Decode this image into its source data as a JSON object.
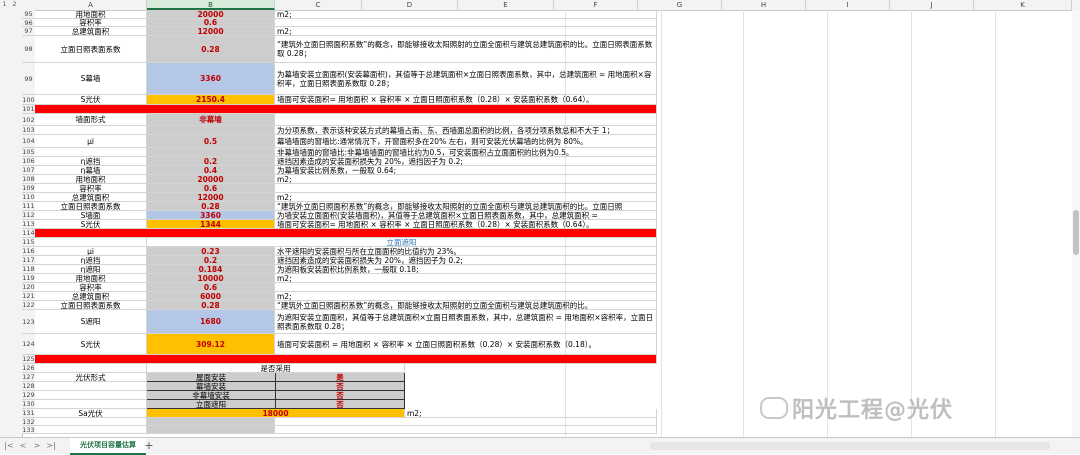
{
  "columns": [
    "A",
    "B",
    "C",
    "D",
    "E",
    "F",
    "G",
    "H",
    "I",
    "J",
    "K"
  ],
  "outline_buttons": [
    "1",
    "2"
  ],
  "rows": [
    {
      "n": "95",
      "a": "用地面积",
      "b": "20000",
      "c": "m2;"
    },
    {
      "n": "96",
      "a": "容积率",
      "b": "0.6",
      "c": ""
    },
    {
      "n": "97",
      "a": "总建筑面积",
      "b": "12000",
      "c": "m2;"
    },
    {
      "n": "98",
      "a": "立面日照表面系数",
      "b": "0.28",
      "c": "“建筑外立面日照面积系数”的概念，即能够接收太阳照射的立面全面积与建筑总建筑面积的比。立面日照表面系数取 0.28；"
    },
    {
      "n": "99",
      "a": "S幕墙",
      "b": "3360",
      "c": "为幕墙安装立面面积(安装幕面积)，其值等于总建筑面积×立面日照表面系数，其中，总建筑面积 = 用地面积×容积率，立面日照表面系数取 0.28；"
    },
    {
      "n": "100",
      "a": "S光伏",
      "b": "2150.4",
      "c": "墙面可安装面积= 用地面积 × 容积率 × 立面日照面积系数（0.28）× 安装面积系数（0.64）。"
    },
    {
      "n": "101",
      "a": "",
      "b": "",
      "c": ""
    },
    {
      "n": "102",
      "a": "墙面形式",
      "b": "非幕墙",
      "c": ""
    },
    {
      "n": "103",
      "a": "",
      "b": "",
      "c": "为分项系数，表示该种安装方式的幕墙占南、东、西墙面总面积的比例，各项分项系数总和不大于 1；"
    },
    {
      "n": "104",
      "a": "μi",
      "b": "0.5",
      "c": "幕墙墙面的窗墙比:通常情况下，开窗面积多在20% 左右，则可安装光伏幕墙的比例为 80%。"
    },
    {
      "n": "105",
      "a": "",
      "b": "",
      "c": "非幕墙墙面的窗墙比:非幕墙墙面的窗墙比约为0.5，可安装面积占立面面积的比例为0.5。"
    },
    {
      "n": "106",
      "a": "η遮挡",
      "b": "0.2",
      "c": "遮挡因素造成的安装面积损失为 20%，遮挡因子为 0.2;"
    },
    {
      "n": "107",
      "a": "η幕墙",
      "b": "0.4",
      "c": "为幕墙安装比例系数，一般取 0.64;"
    },
    {
      "n": "108",
      "a": "用地面积",
      "b": "20000",
      "c": "m2;"
    },
    {
      "n": "109",
      "a": "容积率",
      "b": "0.6",
      "c": ""
    },
    {
      "n": "110",
      "a": "总建筑面积",
      "b": "12000",
      "c": "m2;"
    },
    {
      "n": "111",
      "a": "立面日照表面系数",
      "b": "0.28",
      "c": "“建筑外立面日照面积系数”的概念，即能够接收太阳照射的立面全面积与建筑总建筑面积的比。立面日照"
    },
    {
      "n": "112",
      "a": "S墙面",
      "b": "3360",
      "c": "为墙安装立面面积(安装墙面积)，其值等于总建筑面积×立面日照表面系数，其中，总建筑面积 ="
    },
    {
      "n": "113",
      "a": "S光伏",
      "b": "1344",
      "c": "墙面可安装面积= 用地面积 × 容积率 × 立面日照面积系数（0.28）× 安装面积系数（0.64）。"
    },
    {
      "n": "114",
      "a": "",
      "b": "",
      "c": ""
    },
    {
      "n": "115",
      "a": "",
      "b": "",
      "c": "立面遮阳"
    },
    {
      "n": "116",
      "a": "μi",
      "b": "0.23",
      "c": "水平遮阳的安装面积与所在立面面积的比值约为 23%。"
    },
    {
      "n": "117",
      "a": "η遮挡",
      "b": "0.2",
      "c": "遮挡因素造成的安装面积损失为 20%，遮挡因子为 0.2;"
    },
    {
      "n": "118",
      "a": "η遮阳",
      "b": "0.184",
      "c": "为遮阳板安装面积比例系数，一般取 0.18;"
    },
    {
      "n": "119",
      "a": "用地面积",
      "b": "10000",
      "c": "m2;"
    },
    {
      "n": "120",
      "a": "容积率",
      "b": "0.6",
      "c": ""
    },
    {
      "n": "121",
      "a": "总建筑面积",
      "b": "6000",
      "c": "m2;"
    },
    {
      "n": "122",
      "a": "立面日照表面系数",
      "b": "0.28",
      "c": "“建筑外立面日照面积系数”的概念，即能够接收太阳照射的立面全面积与建筑总建筑面积的比。"
    },
    {
      "n": "123",
      "a": "S遮阳",
      "b": "1680",
      "c": "为遮阳安装立面面积，其值等于总建筑面积×立面日照表面系数，其中，总建筑面积 = 用地面积×容积率，立面日照表面系数取 0.28；"
    },
    {
      "n": "124",
      "a": "S光伏",
      "b": "309.12",
      "c": "墙面可安装面积 = 用地面积 × 容积率 × 立面日照面积系数（0.28）× 安装面积系数（0.18）。"
    },
    {
      "n": "125",
      "a": "",
      "b": "",
      "c": ""
    },
    {
      "n": "126",
      "a": "",
      "b": "是否采用",
      "c": ""
    },
    {
      "n": "127",
      "a": "光伏形式",
      "b": "屋面安装",
      "c": "是"
    },
    {
      "n": "128",
      "a": "",
      "b": "幕墙安装",
      "c": "否"
    },
    {
      "n": "129",
      "a": "",
      "b": "非幕墙安装",
      "c": "否"
    },
    {
      "n": "130",
      "a": "",
      "b": "立面遮阳",
      "c": "否"
    },
    {
      "n": "131",
      "a": "Sa光伏",
      "b": "18000",
      "c": "m2;"
    },
    {
      "n": "132",
      "a": "",
      "b": "",
      "c": ""
    },
    {
      "n": "133",
      "a": "",
      "b": "",
      "c": ""
    }
  ],
  "sheet_tab": "光伏项目容量估算",
  "add_tab": "+",
  "nav": [
    "|<",
    "<",
    ">",
    ">|"
  ],
  "watermark": "阳光工程@光伏",
  "colors": {
    "red": "#ff0000",
    "orange": "#ffc000",
    "blue": "#b4c7e7",
    "gray": "#cdcdcd",
    "value": "#c00000",
    "accent": "#217346"
  }
}
